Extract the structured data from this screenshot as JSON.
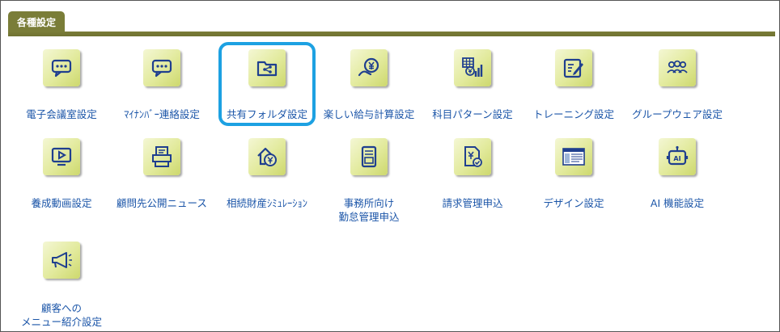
{
  "tab": {
    "label": "各種設定"
  },
  "items": [
    {
      "label": "電子会議室設定",
      "icon": "chat-icon"
    },
    {
      "label": "ﾏｲﾅﾝﾊﾞｰ連絡設定",
      "icon": "chat-icon"
    },
    {
      "label": "共有フォルダ設定",
      "icon": "share-folder-icon"
    },
    {
      "label": "楽しい給与計算設定",
      "icon": "payroll-icon"
    },
    {
      "label": "科目パターン設定",
      "icon": "account-pattern-icon"
    },
    {
      "label": "トレーニング設定",
      "icon": "training-icon"
    },
    {
      "label": "グループウェア設定",
      "icon": "groupware-icon"
    },
    {
      "label": "養成動画設定",
      "icon": "video-icon"
    },
    {
      "label": "顧問先公開ニュース",
      "icon": "printer-icon"
    },
    {
      "label": "相続財産ｼﾐｭﾚｰｼｮﾝ",
      "icon": "inheritance-icon"
    },
    {
      "label": "事務所向け",
      "label2": "勤怠管理申込",
      "icon": "attendance-icon"
    },
    {
      "label": "請求管理申込",
      "icon": "billing-icon"
    },
    {
      "label": "デザイン設定",
      "icon": "design-icon"
    },
    {
      "label": "AI 機能設定",
      "icon": "ai-icon"
    },
    {
      "label": "顧客への",
      "label2": "メニュー紹介設定",
      "icon": "megaphone-icon"
    }
  ],
  "colors": {
    "tab": "#7a7d38",
    "link": "#1b55a8",
    "highlight": "#1da1e2",
    "icon_stroke": "#1f3f8f"
  }
}
